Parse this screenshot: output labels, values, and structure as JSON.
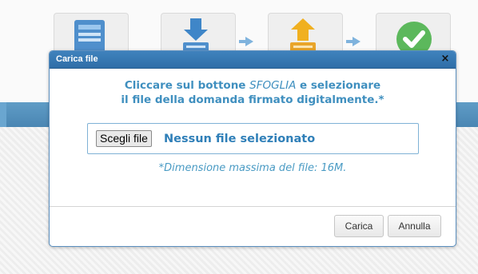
{
  "dialog": {
    "title": "Carica file",
    "close_glyph": "×",
    "instruction_part1": "Cliccare sul bottone ",
    "instruction_emphasis": "SFOGLIA",
    "instruction_part2": " e selezionare",
    "instruction_line2": "il file della domanda firmato digitalmente.*",
    "file_button_label": "Scegli file",
    "file_status": "Nessun file selezionato",
    "max_size_note": "*Dimensione massima del file: 16M.",
    "upload_button_label": "Carica",
    "cancel_button_label": "Annulla"
  },
  "background_steps": [
    {
      "icon": "document-icon"
    },
    {
      "icon": "download-icon"
    },
    {
      "icon": "upload-icon"
    },
    {
      "icon": "check-icon"
    }
  ],
  "colors": {
    "titlebar": "#3578b5",
    "accent_text": "#3f8fbf",
    "band": "#5592c0"
  }
}
